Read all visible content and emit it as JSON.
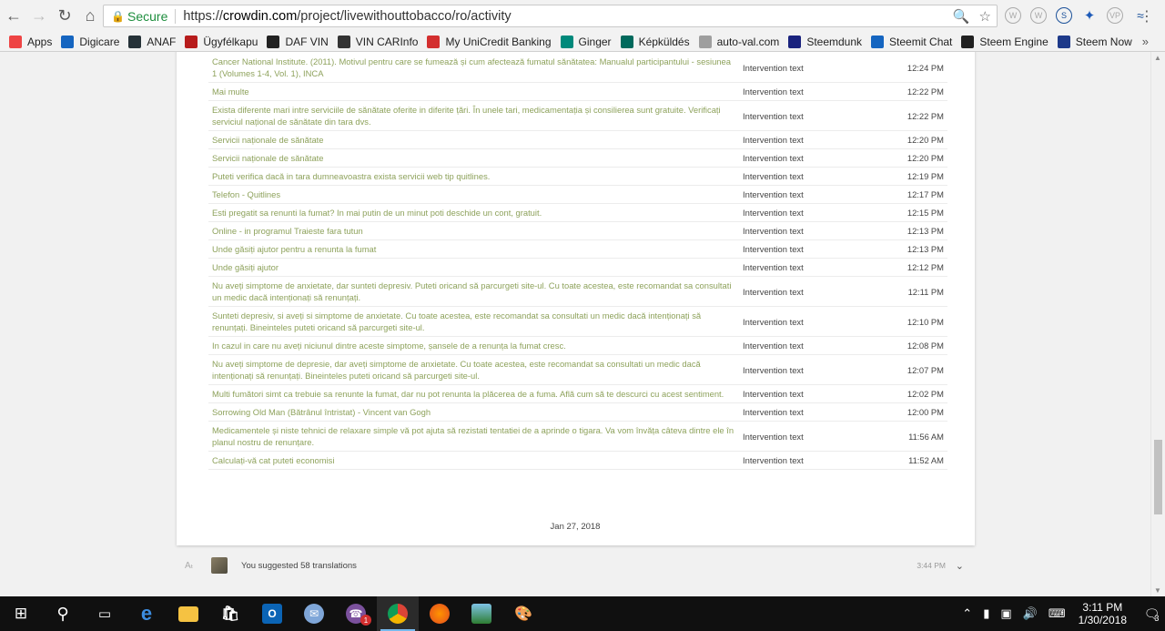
{
  "browser": {
    "secure_label": "Secure",
    "url_scheme": "https://",
    "url_host": "crowdin.com",
    "url_path": "/project/livewithouttobacco/ro/activity"
  },
  "bookmarks": [
    {
      "label": "Apps",
      "color": "#e44"
    },
    {
      "label": "Digicare",
      "color": "#1565c0"
    },
    {
      "label": "ANAF",
      "color": "#263238"
    },
    {
      "label": "Ügyfélkapu",
      "color": "#b71c1c"
    },
    {
      "label": "DAF VIN",
      "color": "#222"
    },
    {
      "label": "VIN CARInfo",
      "color": "#333"
    },
    {
      "label": "My UniCredit Banking",
      "color": "#d32f2f"
    },
    {
      "label": "Ginger",
      "color": "#00897b"
    },
    {
      "label": "Képküldés",
      "color": "#00695c"
    },
    {
      "label": "auto-val.com",
      "color": "#9e9e9e"
    },
    {
      "label": "Steemdunk",
      "color": "#1a237e"
    },
    {
      "label": "Steemit Chat",
      "color": "#1565c0"
    },
    {
      "label": "Steem Engine",
      "color": "#212121"
    },
    {
      "label": "Steem Now",
      "color": "#1e3a8a"
    }
  ],
  "activity_rows": [
    {
      "text": "Cancer National Institute. (2011). Motivul pentru care se fumează și cum afectează fumatul sănătatea: Manualul participantului - sesiunea 1 (Volumes 1-4, Vol. 1), INCA",
      "kind": "Intervention text",
      "time": "12:24 PM"
    },
    {
      "text": "Mai multe",
      "kind": "Intervention text",
      "time": "12:22 PM"
    },
    {
      "text": "Exista diferente mari intre serviciile de sănătate oferite in diferite țări. În unele tari, medicamentația și consilierea sunt gratuite. Verificați serviciul național de sănătate din tara dvs.",
      "kind": "Intervention text",
      "time": "12:22 PM"
    },
    {
      "text": "Servicii naționale de sănătate",
      "kind": "Intervention text",
      "time": "12:20 PM"
    },
    {
      "text": "Servicii naționale de sănătate",
      "kind": "Intervention text",
      "time": "12:20 PM"
    },
    {
      "text": "Puteti verifica dacă in tara dumneavoastra exista servicii web tip quitlines.",
      "kind": "Intervention text",
      "time": "12:19 PM"
    },
    {
      "text": "Telefon - Quitlines",
      "kind": "Intervention text",
      "time": "12:17 PM"
    },
    {
      "text": "Esti pregatit sa renunti la fumat? In mai putin de un minut poti deschide un cont, gratuit.",
      "kind": "Intervention text",
      "time": "12:15 PM"
    },
    {
      "text": "Online - in programul Traieste fara tutun",
      "kind": "Intervention text",
      "time": "12:13 PM"
    },
    {
      "text": "Unde găsiți ajutor pentru a renunta la fumat",
      "kind": "Intervention text",
      "time": "12:13 PM"
    },
    {
      "text": "Unde găsiți ajutor",
      "kind": "Intervention text",
      "time": "12:12 PM"
    },
    {
      "text": "Nu aveți simptome de anxietate, dar sunteti depresiv. Puteti oricand să parcurgeti site-ul. Cu toate acestea, este recomandat sa consultati un medic dacă intenționați să renunțați.",
      "kind": "Intervention text",
      "time": "12:11 PM"
    },
    {
      "text": "Sunteti depresiv, si aveți si simptome de anxietate. Cu toate acestea, este recomandat sa consultati un medic dacă intenționați să renunțați. Bineinteles puteti oricand să parcurgeti site-ul.",
      "kind": "Intervention text",
      "time": "12:10 PM"
    },
    {
      "text": "In cazul in care nu aveți niciunul dintre aceste simptome, șansele de a renunța la fumat cresc.",
      "kind": "Intervention text",
      "time": "12:08 PM"
    },
    {
      "text": "Nu aveți simptome de depresie, dar aveți simptome de anxietate. Cu toate acestea, este recomandat sa consultati un medic dacă intenționați să renunțați. Bineinteles puteti oricand să parcurgeti site-ul.",
      "kind": "Intervention text",
      "time": "12:07 PM"
    },
    {
      "text": "Multi fumători simt ca trebuie sa renunte la fumat, dar nu pot renunta la plăcerea de a fuma. Află cum să te descurci cu acest sentiment.",
      "kind": "Intervention text",
      "time": "12:02 PM"
    },
    {
      "text": "Sorrowing Old Man (Bătrânul întristat) - Vincent van Gogh",
      "kind": "Intervention text",
      "time": "12:00 PM"
    },
    {
      "text": "Medicamentele și niste tehnici de relaxare simple vă pot ajuta să rezistati tentatiei de a aprinde o tigara. Va vom învăța câteva dintre ele în planul nostru de renunțare.",
      "kind": "Intervention text",
      "time": "11:56 AM"
    },
    {
      "text": "Calculați-vă cat puteti economisi",
      "kind": "Intervention text",
      "time": "11:52 AM"
    }
  ],
  "date_heading": "Jan 27, 2018",
  "suggestion": {
    "text": "You suggested 58 translations",
    "time": "3:44 PM"
  },
  "taskbar": {
    "time": "3:11 PM",
    "date": "1/30/2018",
    "notif_count": "3",
    "viber_badge": "1"
  }
}
